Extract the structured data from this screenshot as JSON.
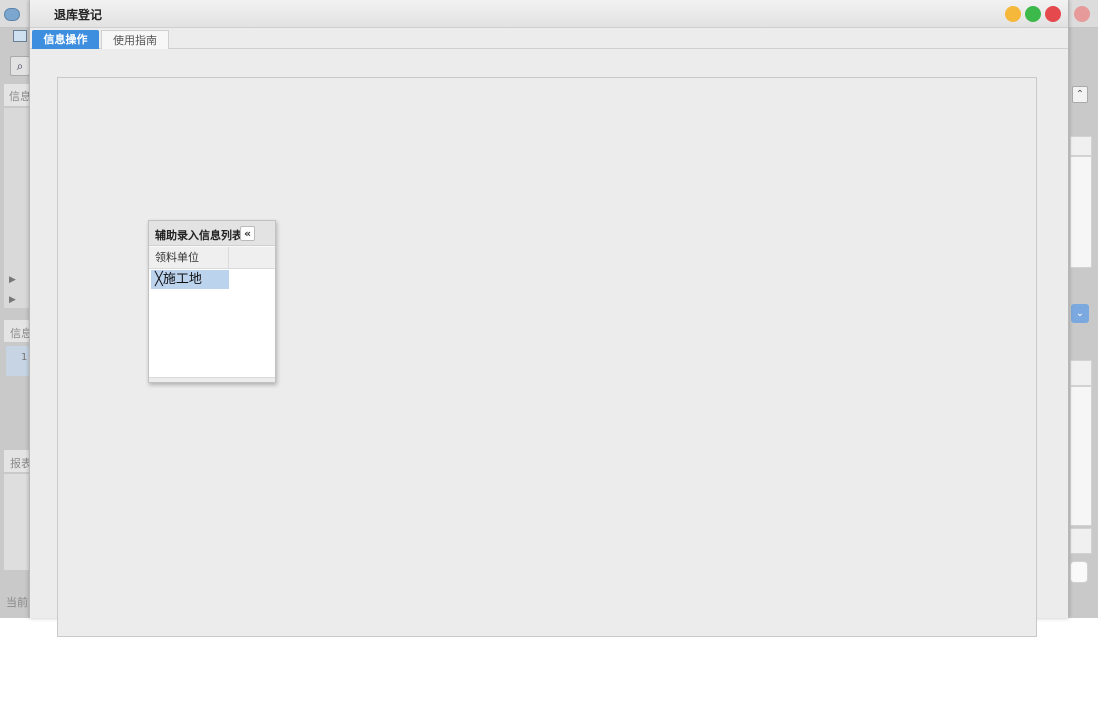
{
  "background_window": {
    "title": "",
    "panel_labels": [
      "信息",
      "信息",
      "报表"
    ],
    "status_text": "当前",
    "row_number": "1",
    "collapse_glyph": "⌃",
    "dropdown_glyph": "⌄"
  },
  "dialog": {
    "title": "退库登记",
    "window_buttons": {
      "minimize_color": "#f5b83a",
      "maximize_color": "#3cb94a",
      "close_color": "#e5484d"
    },
    "tabs": [
      {
        "label": "信息操作",
        "active": true
      },
      {
        "label": "使用指南",
        "active": false
      }
    ]
  },
  "assist_panel": {
    "title": "辅助录入信息列表",
    "collapse_glyph": "«",
    "column_header": "领料单位",
    "items": [
      {
        "label": "╳施工地",
        "selected": true
      }
    ]
  },
  "colors": {
    "accent": "#3e8ee0",
    "selection": "#bcd3ee",
    "dialog_bg": "#ececec"
  }
}
